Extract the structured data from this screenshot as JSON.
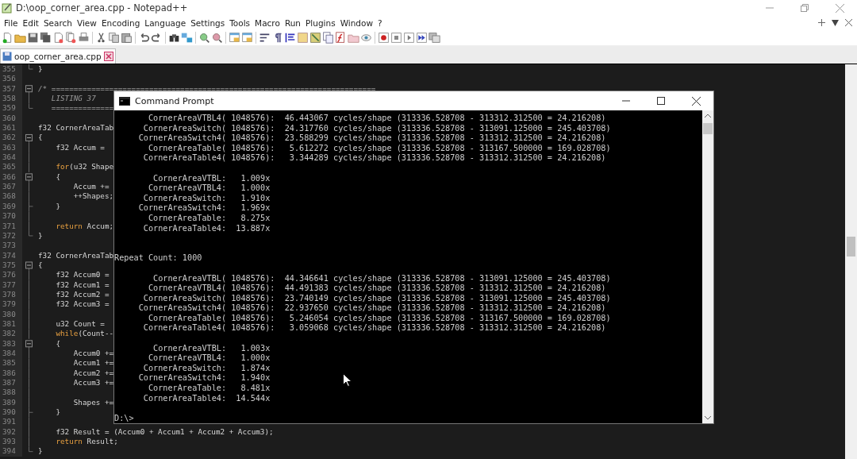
{
  "window": {
    "title": "D:\\oop_corner_area.cpp - Notepad++"
  },
  "menu": [
    "File",
    "Edit",
    "Search",
    "View",
    "Encoding",
    "Language",
    "Settings",
    "Tools",
    "Macro",
    "Run",
    "Plugins",
    "Window",
    "?"
  ],
  "tabs": [
    {
      "label": "oop_corner_area.cpp",
      "selected": true
    }
  ],
  "editor": {
    "lines": [
      {
        "number": "355",
        "kind": "fold-end",
        "parts": [
          {
            "kind": "plain",
            "text": "}"
          }
        ]
      },
      {
        "number": "356"
      },
      {
        "number": "357",
        "kind": "fold-start",
        "parts": [
          {
            "kind": "comment",
            "text": "/* ========================================================================="
          }
        ]
      },
      {
        "number": "358",
        "kind": "fold-body",
        "parts": [
          {
            "kind": "comment",
            "text": "   LISTING 37"
          }
        ]
      },
      {
        "number": "359",
        "kind": "fold-end",
        "parts": [
          {
            "kind": "comment",
            "text": "   =============="
          }
        ]
      },
      {
        "number": "360"
      },
      {
        "number": "361",
        "parts": [
          {
            "kind": "plain",
            "text": "f32 CornerAreaTab"
          }
        ]
      },
      {
        "number": "362",
        "kind": "fold-start",
        "parts": [
          {
            "kind": "plain",
            "text": "{"
          }
        ]
      },
      {
        "number": "363",
        "kind": "fold-body",
        "parts": [
          {
            "kind": "plain",
            "text": "    f32 Accum ="
          }
        ]
      },
      {
        "number": "364",
        "kind": "fold-body"
      },
      {
        "number": "365",
        "kind": "fold-body",
        "parts": [
          {
            "kind": "keyword",
            "text": "    for"
          },
          {
            "kind": "plain",
            "text": "(u32 Shape"
          }
        ]
      },
      {
        "number": "366",
        "kind": "fold-start",
        "parts": [
          {
            "kind": "plain",
            "text": "    {"
          }
        ]
      },
      {
        "number": "367",
        "kind": "fold-body",
        "parts": [
          {
            "kind": "plain",
            "text": "        Accum +="
          }
        ]
      },
      {
        "number": "368",
        "kind": "fold-body",
        "parts": [
          {
            "kind": "plain",
            "text": "        ++Shapes;"
          }
        ]
      },
      {
        "number": "369",
        "kind": "fold-tee",
        "parts": [
          {
            "kind": "plain",
            "text": "    }"
          }
        ]
      },
      {
        "number": "370",
        "kind": "fold-body"
      },
      {
        "number": "371",
        "kind": "fold-body",
        "parts": [
          {
            "kind": "keyword",
            "text": "    return"
          },
          {
            "kind": "plain",
            "text": " Accum;"
          }
        ]
      },
      {
        "number": "372",
        "kind": "fold-end",
        "parts": [
          {
            "kind": "plain",
            "text": "}"
          }
        ]
      },
      {
        "number": "373"
      },
      {
        "number": "374",
        "parts": [
          {
            "kind": "plain",
            "text": "f32 CornerAreaTab"
          }
        ]
      },
      {
        "number": "375",
        "kind": "fold-start",
        "parts": [
          {
            "kind": "plain",
            "text": "{"
          }
        ]
      },
      {
        "number": "376",
        "kind": "fold-body",
        "parts": [
          {
            "kind": "plain",
            "text": "    f32 Accum0 ="
          }
        ]
      },
      {
        "number": "377",
        "kind": "fold-body",
        "parts": [
          {
            "kind": "plain",
            "text": "    f32 Accum1 ="
          }
        ]
      },
      {
        "number": "378",
        "kind": "fold-body",
        "parts": [
          {
            "kind": "plain",
            "text": "    f32 Accum2 ="
          }
        ]
      },
      {
        "number": "379",
        "kind": "fold-body",
        "parts": [
          {
            "kind": "plain",
            "text": "    f32 Accum3 ="
          }
        ]
      },
      {
        "number": "380",
        "kind": "fold-body"
      },
      {
        "number": "381",
        "kind": "fold-body",
        "parts": [
          {
            "kind": "plain",
            "text": "    u32 Count ="
          }
        ]
      },
      {
        "number": "382",
        "kind": "fold-body",
        "parts": [
          {
            "kind": "keyword",
            "text": "    while"
          },
          {
            "kind": "plain",
            "text": "(Count--"
          }
        ]
      },
      {
        "number": "383",
        "kind": "fold-start",
        "parts": [
          {
            "kind": "plain",
            "text": "    {"
          }
        ]
      },
      {
        "number": "384",
        "kind": "fold-body",
        "parts": [
          {
            "kind": "plain",
            "text": "        Accum0 +="
          }
        ]
      },
      {
        "number": "385",
        "kind": "fold-body",
        "parts": [
          {
            "kind": "plain",
            "text": "        Accum1 +="
          }
        ]
      },
      {
        "number": "386",
        "kind": "fold-body",
        "parts": [
          {
            "kind": "plain",
            "text": "        Accum2 +="
          }
        ]
      },
      {
        "number": "387",
        "kind": "fold-body",
        "parts": [
          {
            "kind": "plain",
            "text": "        Accum3 +="
          }
        ]
      },
      {
        "number": "388",
        "kind": "fold-body"
      },
      {
        "number": "389",
        "kind": "fold-body",
        "parts": [
          {
            "kind": "plain",
            "text": "        Shapes +="
          }
        ]
      },
      {
        "number": "390",
        "kind": "fold-tee",
        "parts": [
          {
            "kind": "plain",
            "text": "    }"
          }
        ]
      },
      {
        "number": "391",
        "kind": "fold-body"
      },
      {
        "number": "392",
        "kind": "fold-body",
        "parts": [
          {
            "kind": "plain",
            "text": "    f32 Result = (Accum0 + Accum1 + Accum2 + Accum3);"
          }
        ]
      },
      {
        "number": "393",
        "kind": "fold-body",
        "parts": [
          {
            "kind": "keyword",
            "text": "    return"
          },
          {
            "kind": "plain",
            "text": " Result;"
          }
        ]
      },
      {
        "number": "394",
        "kind": "fold-end",
        "parts": [
          {
            "kind": "plain",
            "text": "}"
          }
        ]
      }
    ]
  },
  "console": {
    "title": "Command Prompt",
    "blocks": [
      {
        "kind": "output",
        "lines": [
          "       CornerAreaVTBL4( 1048576):  46.443067 cycles/shape (313336.528708 - 313312.312500 = 24.216208)",
          "      CornerAreaSwitch( 1048576):  24.317760 cycles/shape (313336.528708 - 313091.125000 = 245.403708)",
          "     CornerAreaSwitch4( 1048576):  23.588299 cycles/shape (313336.528708 - 313312.312500 = 24.216208)",
          "       CornerAreaTable( 1048576):   5.612272 cycles/shape (313336.528708 - 313167.500000 = 169.028708)",
          "      CornerAreaTable4( 1048576):   3.344289 cycles/shape (313336.528708 - 313312.312500 = 24.216208)"
        ]
      },
      {
        "kind": "output",
        "lines": [
          "        CornerAreaVTBL:   1.009x",
          "       CornerAreaVTBL4:   1.000x",
          "      CornerAreaSwitch:   1.910x",
          "     CornerAreaSwitch4:   1.969x",
          "       CornerAreaTable:   8.275x",
          "      CornerAreaTable4:  13.887x"
        ]
      },
      {
        "kind": "heading",
        "lines": [
          "Repeat Count: 1000"
        ]
      },
      {
        "kind": "output",
        "lines": [
          "        CornerAreaVTBL( 1048576):  44.346641 cycles/shape (313336.528708 - 313091.125000 = 245.403708)",
          "       CornerAreaVTBL4( 1048576):  44.491383 cycles/shape (313336.528708 - 313312.312500 = 24.216208)",
          "      CornerAreaSwitch( 1048576):  23.740149 cycles/shape (313336.528708 - 313091.125000 = 245.403708)",
          "     CornerAreaSwitch4( 1048576):  22.937650 cycles/shape (313336.528708 - 313312.312500 = 24.216208)",
          "       CornerAreaTable( 1048576):   5.246054 cycles/shape (313336.528708 - 313167.500000 = 169.028708)",
          "      CornerAreaTable4( 1048576):   3.059068 cycles/shape (313336.528708 - 313312.312500 = 24.216208)"
        ]
      },
      {
        "kind": "output",
        "lines": [
          "        CornerAreaVTBL:   1.003x",
          "       CornerAreaVTBL4:   1.000x",
          "      CornerAreaSwitch:   1.874x",
          "     CornerAreaSwitch4:   1.940x",
          "       CornerAreaTable:   8.481x",
          "      CornerAreaTable4:  14.544x"
        ]
      },
      {
        "kind": "output",
        "lines": [
          "D:\\>"
        ]
      }
    ]
  }
}
